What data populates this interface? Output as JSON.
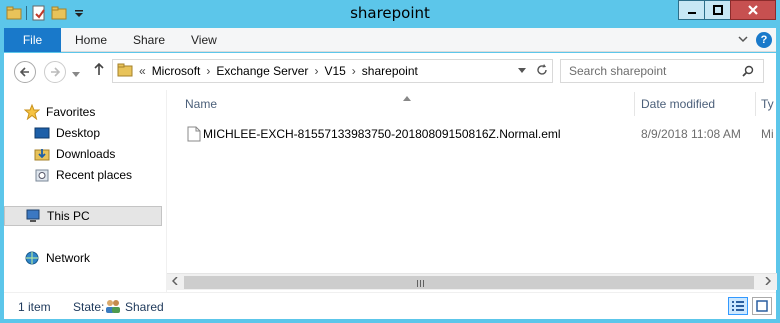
{
  "window": {
    "title": "sharepoint"
  },
  "ribbon": {
    "tabs": [
      "File",
      "Home",
      "Share",
      "View"
    ]
  },
  "address": {
    "overflow": "«",
    "crumbs": [
      "Microsoft",
      "Exchange Server",
      "V15",
      "sharepoint"
    ],
    "separator": "›"
  },
  "search": {
    "placeholder": "Search sharepoint"
  },
  "nav": {
    "favorites_label": "Favorites",
    "favorites": [
      "Desktop",
      "Downloads",
      "Recent places"
    ],
    "this_pc": "This PC",
    "network": "Network"
  },
  "columns": {
    "name": "Name",
    "date": "Date modified",
    "type": "Ty"
  },
  "files": [
    {
      "name": "MICHLEE-EXCH-81557133983750-20180809150816Z.Normal.eml",
      "date": "8/9/2018 11:08 AM",
      "type": "Mi"
    }
  ],
  "statusbar": {
    "count": "1 item",
    "state_label": "State:",
    "state_value": "Shared"
  },
  "colors": {
    "frame": "#5cc6ea",
    "file_tab": "#1979ca",
    "close": "#c75050"
  }
}
